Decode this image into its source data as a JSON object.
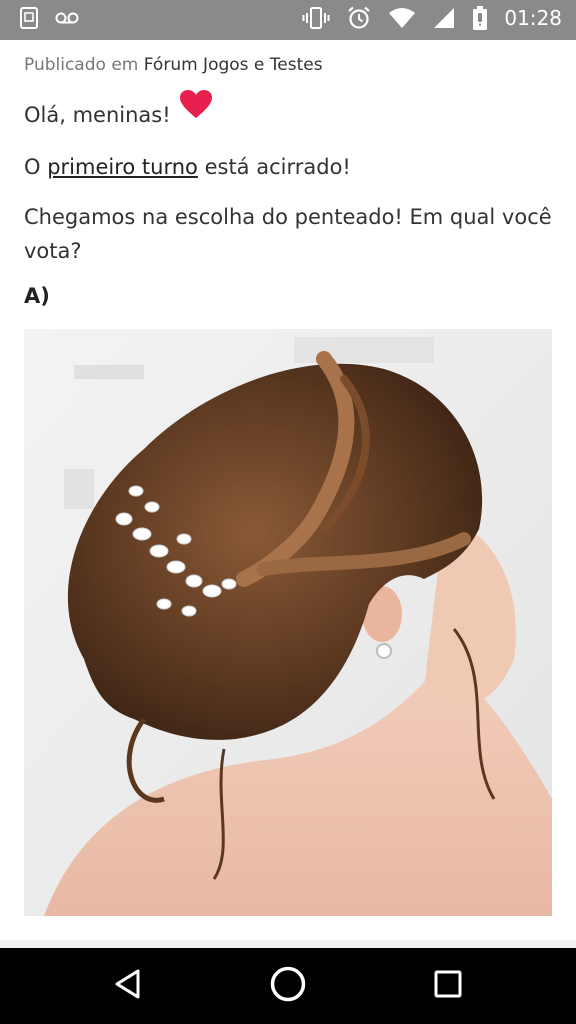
{
  "status_bar": {
    "time": "01:28",
    "icons_left": [
      "screenshot-icon",
      "voicemail-icon"
    ],
    "icons_right": [
      "vibrate-icon",
      "alarm-icon",
      "wifi-icon",
      "signal-icon",
      "battery-icon"
    ]
  },
  "post": {
    "published_prefix": "Publicado em",
    "forum_name": "Fórum Jogos e Testes",
    "greeting": "Olá, meninas!",
    "turno_prefix": "O",
    "turno_link": "primeiro turno",
    "turno_suffix": "está acirrado!",
    "question": "Chegamos na escolha do penteado! Em qual você vota?",
    "option_label": "A)",
    "heart_color": "#e8204f"
  },
  "nav_bar": {
    "buttons": [
      "back-icon",
      "home-icon",
      "recents-icon"
    ]
  }
}
